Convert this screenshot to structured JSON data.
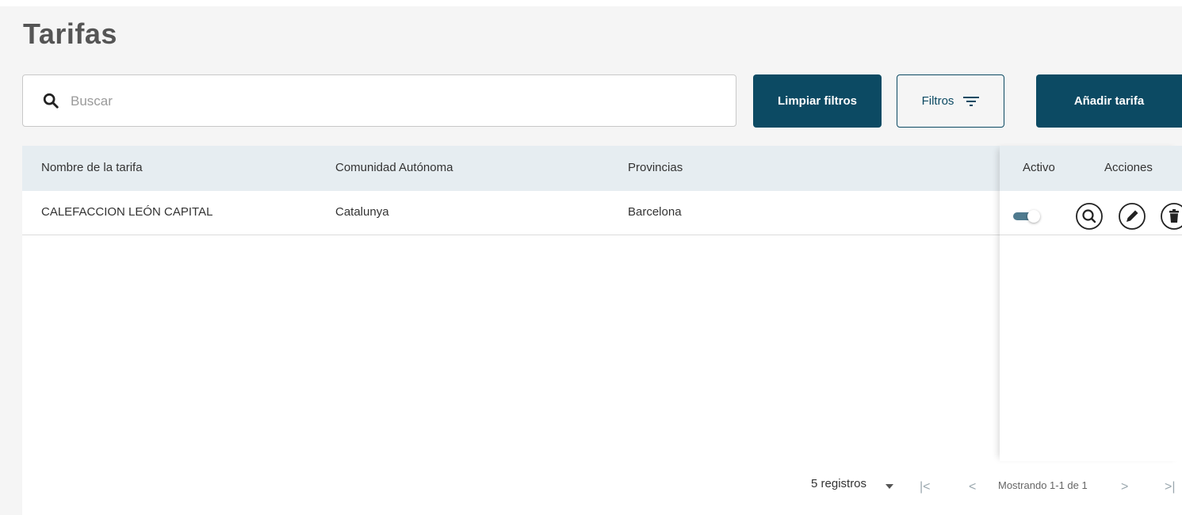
{
  "page": {
    "title": "Tarifas"
  },
  "search": {
    "placeholder": "Buscar",
    "icon": "search-icon"
  },
  "toolbar": {
    "clear_filters_label": "Limpiar filtros",
    "filters_label": "Filtros",
    "add_label": "Añadir tarifa"
  },
  "table": {
    "headers": {
      "name": "Nombre de la tarifa",
      "community": "Comunidad Autónoma",
      "provinces": "Provincias",
      "active": "Activo",
      "actions": "Acciones"
    },
    "rows": [
      {
        "name": "CALEFACCION LEÓN CAPITAL",
        "community": "Catalunya",
        "provinces": "Barcelona",
        "active": true
      }
    ]
  },
  "pagination": {
    "page_size_label": "5 registros",
    "status": "Mostrando 1-1 de 1",
    "first": "|<",
    "prev": "<",
    "next": ">",
    "last": ">|"
  },
  "colors": {
    "primary": "#0c4a63",
    "header_bg": "#e6edf1",
    "page_bg": "#f5f5f5"
  }
}
